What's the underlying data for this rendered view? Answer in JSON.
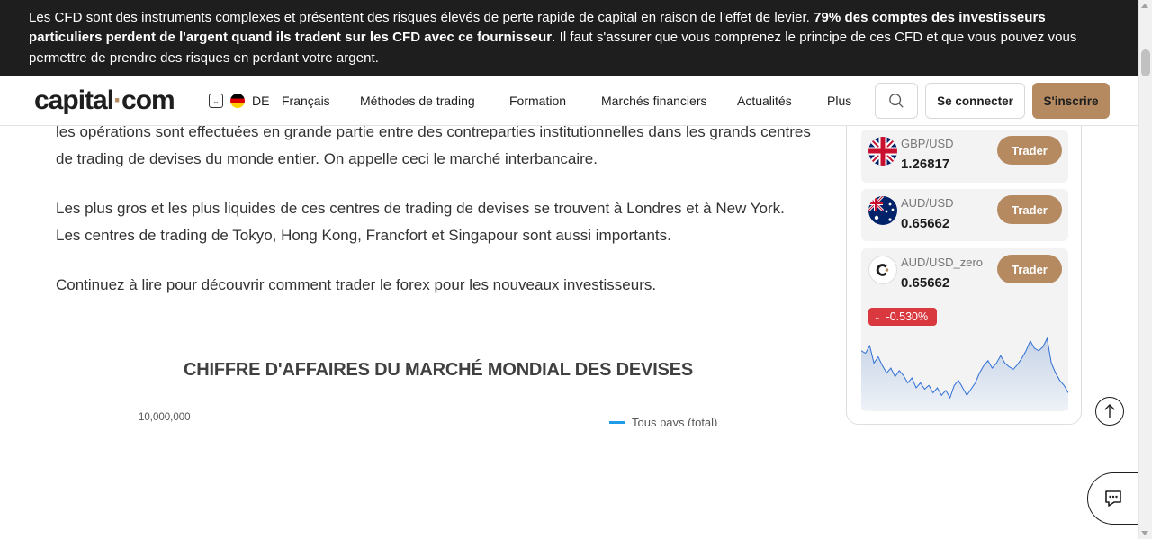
{
  "risk_banner": {
    "text_before": "Les CFD sont des instruments complexes et présentent des risques élevés de perte rapide de capital en raison de l'effet de levier. ",
    "text_bold": "79% des comptes des investisseurs particuliers perdent de l'argent quand ils tradent sur les CFD avec ce fournisseur",
    "text_after": ". Il faut s'assurer que vous comprenez le principe de ces CFD et que vous pouvez vous permettre de prendre des risques en perdant votre argent."
  },
  "header": {
    "logo_main": "capital",
    "logo_dot": "·",
    "logo_end": "com",
    "language_code": "DE",
    "language_name": "Français",
    "nav": [
      "Méthodes de trading",
      "Formation",
      "Marchés financiers",
      "Actualités",
      "Plus"
    ],
    "login_label": "Se connecter",
    "signup_label": "S'inscrire"
  },
  "article": {
    "para1": "les opérations sont effectuées en grande partie entre des contreparties institutionnelles dans les grands centres de trading de devises du monde entier. On appelle ceci le marché interbancaire.",
    "para2": "Les plus gros et les plus liquides de ces centres de trading de devises se trouvent à Londres et à New York. Les centres de trading de Tokyo, Hong Kong, Francfort et Singapour sont aussi importants.",
    "para3": "Continuez à lire pour découvrir comment trader le forex pour les nouveaux investisseurs."
  },
  "chart_data": {
    "type": "line",
    "title": "CHIFFRE D'AFFAIRES DU MARCHÉ MONDIAL DES DEVISES",
    "y_ticks": [
      "10,000,000"
    ],
    "series": [
      {
        "name": "Tous pays (total)",
        "color": "#1e9be9",
        "values": []
      }
    ],
    "legend_position": "right"
  },
  "widget": {
    "trade_label": "Trader",
    "instruments": [
      {
        "symbol": "GBP/USD",
        "price": "1.26817",
        "flag": "uk-flag-icon"
      },
      {
        "symbol": "AUD/USD",
        "price": "0.65662",
        "flag": "australia-flag-icon"
      },
      {
        "symbol": "AUD/USD_zero",
        "price": "0.65662",
        "flag": "capital-logo-icon"
      }
    ],
    "change": "-0.530%",
    "change_color": "#d9383e",
    "spark_values": [
      40,
      38,
      44,
      30,
      35,
      28,
      22,
      26,
      19,
      24,
      20,
      14,
      18,
      10,
      14,
      9,
      12,
      6,
      10,
      4,
      8,
      2,
      12,
      16,
      10,
      4,
      9,
      14,
      22,
      28,
      32,
      26,
      30,
      36,
      30,
      27,
      25,
      29,
      34,
      40,
      48,
      42,
      40,
      43,
      50,
      30,
      22,
      16,
      12,
      6
    ]
  },
  "accent_color": "#b58a60"
}
